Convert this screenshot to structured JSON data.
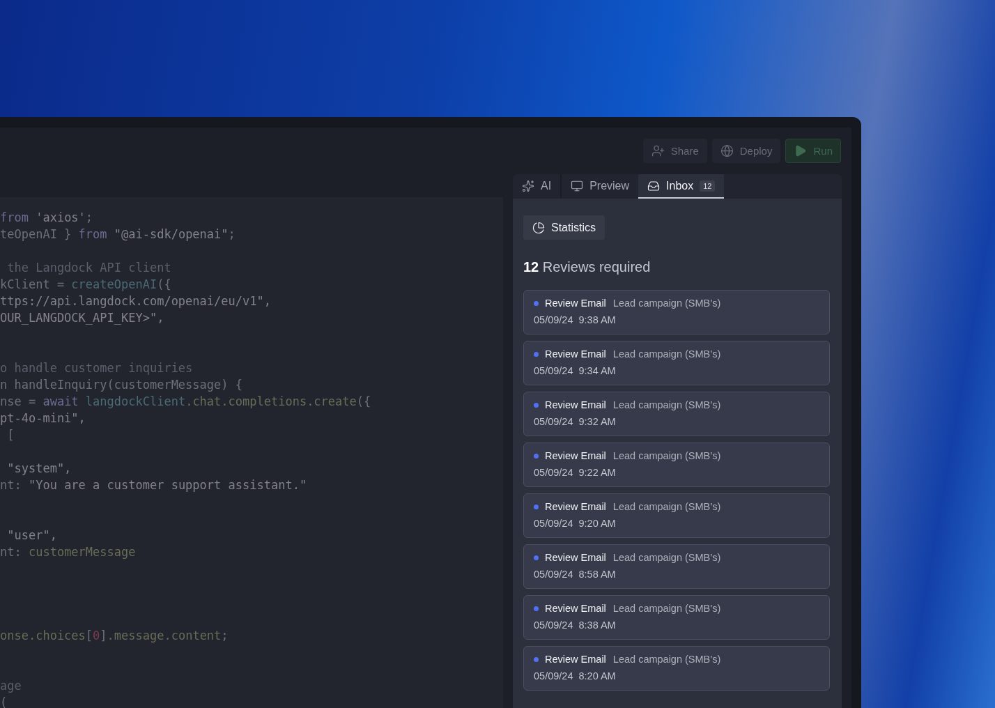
{
  "toolbar": {
    "buttons": [
      {
        "kind": "share",
        "label": "Share"
      },
      {
        "kind": "deploy",
        "label": "Deploy"
      },
      {
        "kind": "run",
        "label": "Run"
      }
    ]
  },
  "editor": {
    "lines": [
      {
        "kind": "code",
        "segments": [
          {
            "kind": "keyword",
            "t": "from"
          },
          {
            "kind": "string",
            "t": " 'axios'"
          },
          {
            "kind": "plain",
            "t": ";"
          }
        ]
      },
      {
        "kind": "code",
        "segments": [
          {
            "kind": "plain",
            "t": "teOpenAI } "
          },
          {
            "kind": "keyword",
            "t": "from"
          },
          {
            "kind": "string",
            "t": " \"@ai-sdk/openai\""
          },
          {
            "kind": "plain",
            "t": ";"
          }
        ]
      },
      {
        "kind": "blank"
      },
      {
        "kind": "code",
        "segments": [
          {
            "kind": "comment",
            "t": " the Langdock API client"
          }
        ]
      },
      {
        "kind": "code",
        "segments": [
          {
            "kind": "plain",
            "t": "kClient = "
          },
          {
            "kind": "function",
            "t": "createOpenAI"
          },
          {
            "kind": "plain",
            "t": "({"
          }
        ]
      },
      {
        "kind": "code",
        "segments": [
          {
            "kind": "string",
            "t": "ttps://api.langdock.com/openai/eu/v1\","
          }
        ]
      },
      {
        "kind": "code",
        "segments": [
          {
            "kind": "string",
            "t": "OUR_LANGDOCK_API_KEY>\","
          }
        ]
      },
      {
        "kind": "blank"
      },
      {
        "kind": "blank"
      },
      {
        "kind": "code",
        "segments": [
          {
            "kind": "comment",
            "t": "o handle customer inquiries"
          }
        ]
      },
      {
        "kind": "code",
        "segments": [
          {
            "kind": "plain",
            "t": "n handleInquiry(customerMessage) {"
          }
        ]
      },
      {
        "kind": "code",
        "segments": [
          {
            "kind": "plain",
            "t": "nse = "
          },
          {
            "kind": "keyword",
            "t": "await"
          },
          {
            "kind": "function",
            "t": " langdockClient"
          },
          {
            "kind": "property",
            "t": ".chat.completions.create"
          },
          {
            "kind": "plain",
            "t": "({"
          }
        ]
      },
      {
        "kind": "code",
        "segments": [
          {
            "kind": "string",
            "t": "pt-4o-mini\","
          }
        ]
      },
      {
        "kind": "code",
        "segments": [
          {
            "kind": "plain",
            "t": " ["
          }
        ]
      },
      {
        "kind": "blank"
      },
      {
        "kind": "code",
        "segments": [
          {
            "kind": "string",
            "t": " \"system\","
          }
        ]
      },
      {
        "kind": "code",
        "segments": [
          {
            "kind": "plain",
            "t": "nt: "
          },
          {
            "kind": "string",
            "t": "\"You are a customer support assistant.\""
          }
        ]
      },
      {
        "kind": "blank"
      },
      {
        "kind": "blank"
      },
      {
        "kind": "code",
        "segments": [
          {
            "kind": "string",
            "t": " \"user\","
          }
        ]
      },
      {
        "kind": "code",
        "segments": [
          {
            "kind": "plain",
            "t": "nt: "
          },
          {
            "kind": "property",
            "t": "customerMessage"
          }
        ]
      },
      {
        "kind": "blank"
      },
      {
        "kind": "blank"
      },
      {
        "kind": "blank"
      },
      {
        "kind": "blank"
      },
      {
        "kind": "code",
        "segments": [
          {
            "kind": "property",
            "t": "onse.choices"
          },
          {
            "kind": "plain",
            "t": "["
          },
          {
            "kind": "number",
            "t": "0"
          },
          {
            "kind": "plain",
            "t": "]"
          },
          {
            "kind": "property",
            "t": ".message.content"
          },
          {
            "kind": "plain",
            "t": ";"
          }
        ]
      },
      {
        "kind": "blank"
      },
      {
        "kind": "blank"
      },
      {
        "kind": "code",
        "segments": [
          {
            "kind": "comment",
            "t": "age"
          }
        ]
      },
      {
        "kind": "code",
        "segments": [
          {
            "kind": "plain",
            "t": "("
          }
        ]
      }
    ]
  },
  "panel": {
    "tabs": [
      {
        "kind": "ai",
        "label": "AI",
        "selected": false
      },
      {
        "kind": "preview",
        "label": "Preview",
        "selected": false
      },
      {
        "kind": "inbox",
        "label": "Inbox",
        "badge": "12",
        "selected": true
      }
    ],
    "statistics_button": "Statistics",
    "heading": "**12** Reviews required",
    "reviews": [
      {
        "title": "Review Email",
        "campaign": "Lead campaign (SMB’s)",
        "date": "05/09/24",
        "time": "9:38 AM"
      },
      {
        "title": "Review Email",
        "campaign": "Lead campaign (SMB’s)",
        "date": "05/09/24",
        "time": "9:34 AM"
      },
      {
        "title": "Review Email",
        "campaign": "Lead campaign (SMB’s)",
        "date": "05/09/24",
        "time": "9:32 AM"
      },
      {
        "title": "Review Email",
        "campaign": "Lead campaign (SMB’s)",
        "date": "05/09/24",
        "time": "9:22 AM"
      },
      {
        "title": "Review Email",
        "campaign": "Lead campaign (SMB’s)",
        "date": "05/09/24",
        "time": "9:20 AM"
      },
      {
        "title": "Review Email",
        "campaign": "Lead campaign (SMB’s)",
        "date": "05/09/24",
        "time": "8:58 AM"
      },
      {
        "title": "Review Email",
        "campaign": "Lead campaign (SMB’s)",
        "date": "05/09/24",
        "time": "8:38 AM"
      },
      {
        "title": "Review Email",
        "campaign": "Lead campaign (SMB’s)",
        "date": "05/09/24",
        "time": "8:20 AM"
      }
    ]
  }
}
